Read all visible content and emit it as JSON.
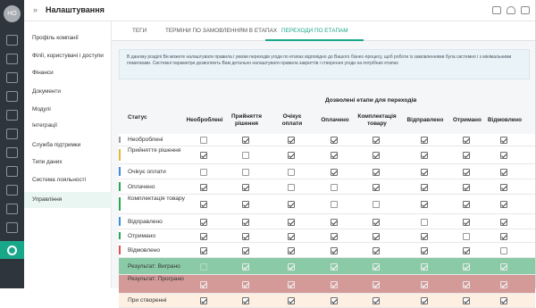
{
  "header": {
    "title": "Налаштування",
    "avatar_initials": "НО"
  },
  "menu": {
    "items": [
      "Профіль компанії",
      "Філії, користувачі і доступи",
      "Фінанси",
      "Документи",
      "Модулі",
      "Інтеграції",
      "Служба підтримки",
      "Типи даних",
      "Система лояльності",
      "Управління"
    ],
    "active_index": 9
  },
  "tabs": [
    "ТЕГИ",
    "ТЕРМІНИ ПО ЗАМОВЛЕННЯМ В ЕТАПАХ",
    "ПЕРЕХОДИ ПО ЕТАПАМ"
  ],
  "active_tab": 2,
  "info_text": "В даному розділі Ви можете налаштувати правила і умови переходів угоди по етапах відповідно до Вашого бізнес-процесу, щоб роботи із замовленнями була системно і з мінімальними помилками. Системні параметри дозволяють Вам детально налаштувати правила закриттів і створення угоди на потрібних етапах",
  "table": {
    "group_title": "Дозволені етапи для переходів",
    "status_header": "Статус",
    "columns": [
      "Необроблені",
      "Прийняття рішення",
      "Очікує оплати",
      "Оплачено",
      "Комплектація товару",
      "Відправлено",
      "Отримано",
      "Відмовлено"
    ],
    "rows": [
      {
        "label": "Необроблені",
        "color": "#9a9a9a",
        "style": "normal",
        "cells": [
          0,
          1,
          1,
          1,
          1,
          1,
          1,
          1
        ]
      },
      {
        "label": "Прийняття рішення",
        "color": "#e2b93b",
        "style": "normal",
        "cells": [
          1,
          0,
          1,
          1,
          1,
          1,
          1,
          1
        ]
      },
      {
        "label": "Очікує оплати",
        "color": "#3a8fd8",
        "style": "normal",
        "cells": [
          0,
          0,
          0,
          1,
          1,
          1,
          1,
          1
        ]
      },
      {
        "label": "Оплачено",
        "color": "#27a84f",
        "style": "normal",
        "cells": [
          1,
          1,
          0,
          0,
          1,
          1,
          1,
          1
        ]
      },
      {
        "label": "Комплектація товару",
        "color": "#27a84f",
        "style": "normal",
        "cells": [
          1,
          1,
          1,
          0,
          0,
          1,
          1,
          1
        ]
      },
      {
        "label": "Відправлено",
        "color": "#3a8fd8",
        "style": "normal",
        "cells": [
          1,
          1,
          1,
          1,
          1,
          0,
          1,
          1
        ]
      },
      {
        "label": "Отримано",
        "color": "#27a84f",
        "style": "normal",
        "cells": [
          1,
          1,
          1,
          1,
          1,
          1,
          0,
          1
        ]
      },
      {
        "label": "Відмовлено",
        "color": "#d9534f",
        "style": "normal",
        "cells": [
          1,
          1,
          1,
          1,
          1,
          1,
          1,
          0
        ]
      },
      {
        "label": "Результат: Виграно",
        "color": "#8bcaa6",
        "style": "green",
        "cells": [
          0,
          1,
          1,
          1,
          1,
          1,
          1,
          1
        ]
      },
      {
        "label": "Результат: Програно",
        "color": "#d39a98",
        "style": "red",
        "cells": [
          1,
          1,
          1,
          1,
          1,
          1,
          1,
          1
        ]
      },
      {
        "label": "При створенні",
        "color": "#fdf0e3",
        "style": "peach",
        "cells": [
          1,
          1,
          1,
          1,
          1,
          1,
          1,
          1
        ]
      }
    ]
  }
}
